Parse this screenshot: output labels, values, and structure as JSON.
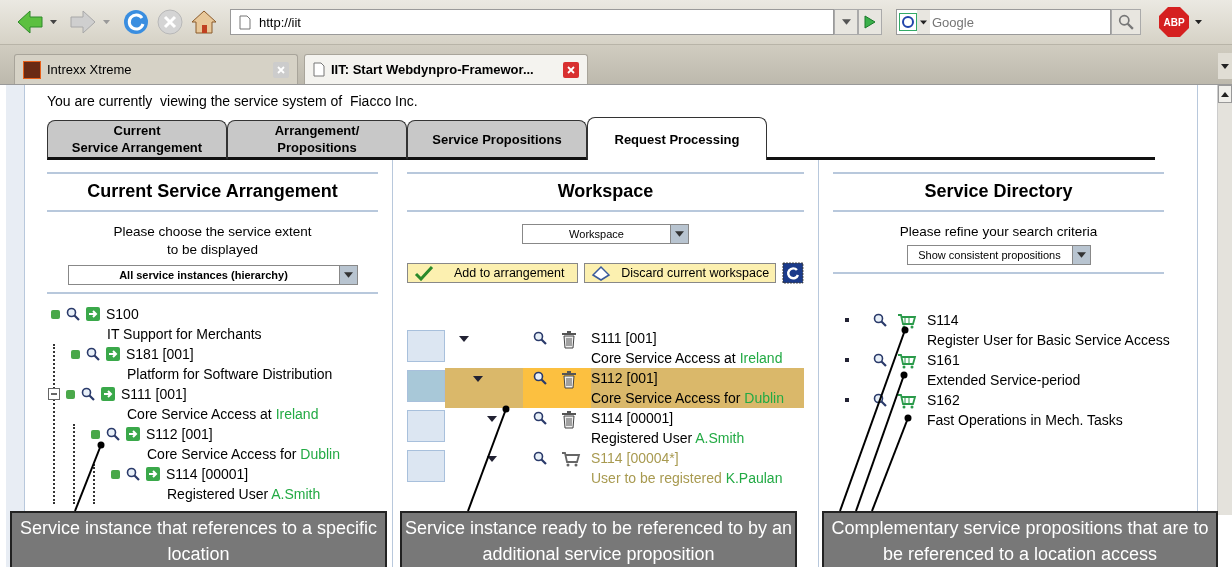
{
  "browser": {
    "url": "http://iit",
    "search_placeholder": "Google",
    "adblock_label": "ABP",
    "tabs": [
      {
        "label": "Intrexx Xtreme",
        "selected": false
      },
      {
        "label": "IIT: Start Webdynpro-Framewor...",
        "selected": true
      }
    ]
  },
  "intro": "You are currently  viewing the service system of  Fiacco Inc.",
  "tabs": [
    {
      "lines": [
        "Current",
        "Service Arrangement"
      ],
      "selected": false
    },
    {
      "lines": [
        "Arrangement/",
        "Propositions"
      ],
      "selected": false
    },
    {
      "lines": [
        "Service Propositions"
      ],
      "selected": false
    },
    {
      "lines": [
        "Request Processing"
      ],
      "selected": true
    }
  ],
  "arrangement": {
    "title": "Current Service Arrangement",
    "prompt": [
      "Please choose the service extent",
      "to be displayed"
    ],
    "dropdown": "All service instances (hierarchy)",
    "tree": [
      {
        "code": "S100",
        "name": "IT Support for Merchants",
        "children": [
          {
            "code": "S181 [001]",
            "name": "Platform for Software Distribution"
          },
          {
            "code": "S111 [001]",
            "name": "Core Service Access at ",
            "location": "Ireland",
            "expanded": true,
            "children": [
              {
                "code": "S112 [001]",
                "name": "Core Service Access for ",
                "location": "Dublin",
                "children": [
                  {
                    "code": "S114 [00001]",
                    "name": "Registered User ",
                    "location": "A.Smith"
                  }
                ]
              }
            ]
          }
        ]
      }
    ]
  },
  "workspace": {
    "title": "Workspace",
    "dropdown": "Workspace",
    "buttons": [
      {
        "kind": "add",
        "label": "Add to arrangement"
      },
      {
        "kind": "discard",
        "label": "Discard current workspace"
      }
    ],
    "rows": [
      {
        "kind": "instance",
        "code": "S111 [001]",
        "name": "Core Service Access at ",
        "location": "Ireland",
        "selected": false,
        "children": [
          {
            "kind": "instance",
            "code": "S112 [001]",
            "name": "Core Service Access for ",
            "location": "Dublin",
            "selected": true,
            "children": [
              {
                "kind": "instance",
                "code": "S114 [00001]",
                "name": "Registered User ",
                "location": "A.Smith",
                "selected": false
              },
              {
                "kind": "proposed",
                "code": "S114 [00004*]",
                "name": "User to be registered ",
                "location": "K.Paulan",
                "selected": false
              }
            ]
          }
        ]
      }
    ]
  },
  "directory": {
    "title": "Service Directory",
    "prompt": "Please refine your search criteria",
    "dropdown": "Show consistent propositions",
    "items": [
      {
        "code": "S114",
        "name": "Register User for Basic Service Access"
      },
      {
        "code": "S161",
        "name": "Extended Service-period"
      },
      {
        "code": "S162",
        "name": "Fast Operations in Mech. Tasks"
      }
    ]
  },
  "callouts": [
    "Service instance that references to a specific location",
    "Service instance ready to be referenced to by an additional service proposition",
    "Complementary service propositions that are to be referenced to a location access"
  ]
}
